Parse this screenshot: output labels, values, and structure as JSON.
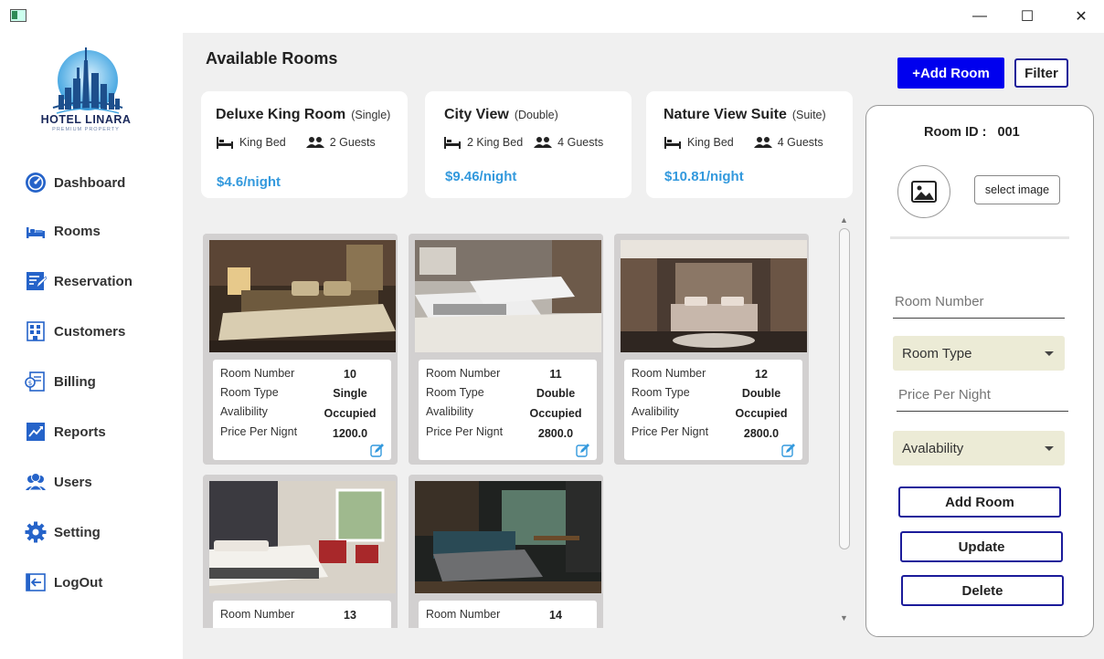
{
  "window": {
    "minimize": "—",
    "maximize": "☐",
    "close": "✕"
  },
  "brand": {
    "name": "HOTEL LINARA",
    "tagline": "PREMIUM PROPERTY"
  },
  "nav": [
    {
      "label": "Dashboard",
      "icon": "dashboard-icon"
    },
    {
      "label": "Rooms",
      "icon": "bed-icon"
    },
    {
      "label": "Reservation",
      "icon": "reservation-icon"
    },
    {
      "label": "Customers",
      "icon": "customers-icon"
    },
    {
      "label": "Billing",
      "icon": "billing-icon"
    },
    {
      "label": "Reports",
      "icon": "reports-icon"
    },
    {
      "label": "Users",
      "icon": "users-icon"
    },
    {
      "label": "Setting",
      "icon": "gear-icon"
    },
    {
      "label": "LogOut",
      "icon": "logout-icon"
    }
  ],
  "header": {
    "title": "Available Rooms",
    "add_room": "+Add Room",
    "filter": "Filter"
  },
  "summary_cards": [
    {
      "name": "Deluxe King Room",
      "type": "(Single)",
      "bed": "King Bed",
      "guests": "2 Guests",
      "price": "$4.6/night"
    },
    {
      "name": "City View",
      "type": "(Double)",
      "bed": "2 King Bed",
      "guests": "4 Guests",
      "price": "$9.46/night"
    },
    {
      "name": "Nature View Suite",
      "type": "(Suite)",
      "bed": "King Bed",
      "guests": "4 Guests",
      "price": "$10.81/night"
    }
  ],
  "room_labels": {
    "number": "Room Number",
    "type": "Room Type",
    "availability": "Avalibility",
    "price": "Price Per Nignt"
  },
  "rooms": [
    {
      "number": "10",
      "type": "Single",
      "availability": "Occupied",
      "price": "1200.0"
    },
    {
      "number": "11",
      "type": "Double",
      "availability": "Occupied",
      "price": "2800.0"
    },
    {
      "number": "12",
      "type": "Double",
      "availability": "Occupied",
      "price": "2800.0"
    },
    {
      "number": "13",
      "type": "",
      "availability": "",
      "price": ""
    },
    {
      "number": "14",
      "type": "",
      "availability": "",
      "price": ""
    }
  ],
  "form": {
    "room_id_label": "Room ID :",
    "room_id_value": "001",
    "select_image": "select image",
    "room_number_placeholder": "Room Number",
    "room_type_label": "Room Type",
    "price_placeholder": "Price Per Night",
    "availability_label": "Avalability",
    "add": "Add Room",
    "update": "Update",
    "delete": "Delete"
  },
  "colors": {
    "accent": "#0000ee",
    "price": "#3399dd",
    "outline": "#1b1b9a",
    "combo": "#ecebd6"
  }
}
